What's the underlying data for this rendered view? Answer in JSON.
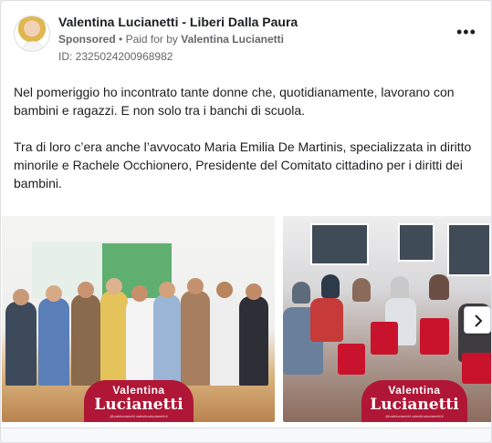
{
  "ad": {
    "page_name": "Valentina Lucianetti - Liberi Dalla Paura",
    "sponsored": "Sponsored",
    "separator": "•",
    "paid_for_prefix": "Paid for by",
    "payer": "Valentina Lucianetti",
    "id_label": "ID: 2325024200968982",
    "more_icon": "more-horizontal-icon",
    "more_glyph": "•••"
  },
  "body": {
    "paragraph_1": "Nel pomeriggio ho incontrato tante donne che, quotidianamente, lavorano con bambini e ragazzi. E non solo tra i banchi di scuola.",
    "paragraph_2": "Tra di loro c’era anche l’avvocato Maria Emilia De Martinis, specializzata in diritto minorile e Rachele Occhionero, Presidente del Comitato cittadino per i diritti dei bambini.",
    "ellipsis": "..."
  },
  "carousel": {
    "cards": [
      {
        "image": "group-photo-women",
        "brand_first": "Valentina",
        "brand_last": "Lucianetti",
        "brand_social": "@valelucianetti   valentinalucianetti.it"
      },
      {
        "image": "audience-red-chairs-photo",
        "brand_first": "Valentina",
        "brand_last": "Lucianetti",
        "brand_social": "@valelucianetti   valentinalucianetti.it"
      }
    ],
    "next_icon": "chevron-right-icon"
  },
  "colors": {
    "brand": "#b01636",
    "sign_green": "#46a35b",
    "chair_red": "#c9132c",
    "meta_grey": "#65676b"
  }
}
